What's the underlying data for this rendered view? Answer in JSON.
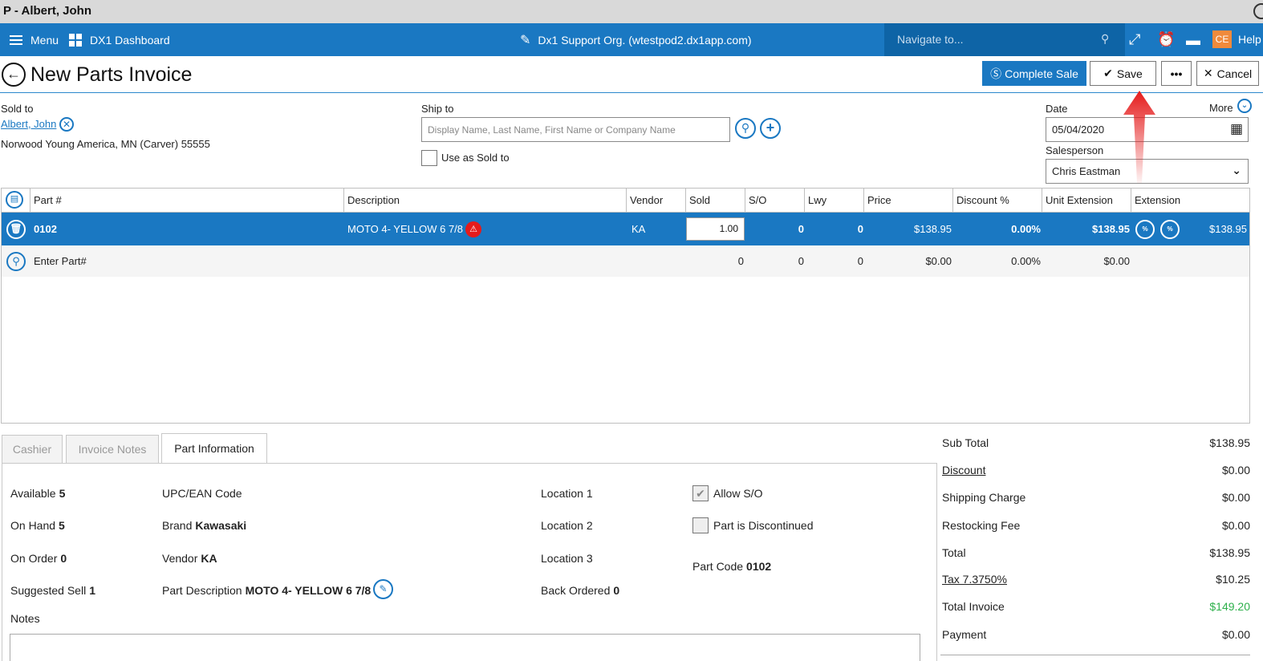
{
  "window": {
    "title": "P - Albert, John"
  },
  "topnav": {
    "menu_label": "Menu",
    "dashboard_label": "DX1 Dashboard",
    "org_label": "Dx1 Support Org. (wtestpod2.dx1app.com)",
    "navigate_placeholder": "Navigate to...",
    "user_initials": "CE",
    "help_label": "Help"
  },
  "header": {
    "title": "New Parts Invoice",
    "complete_sale_label": "Complete Sale",
    "save_label": "Save",
    "more_label": "•••",
    "cancel_label": "Cancel"
  },
  "sold_to": {
    "label": "Sold to",
    "name": "Albert, John",
    "address": "Norwood Young America, MN (Carver) 55555"
  },
  "ship_to": {
    "label": "Ship to",
    "placeholder": "Display Name, Last Name, First Name or Company Name",
    "use_as_sold_label": "Use as Sold to"
  },
  "meta": {
    "more_label": "More",
    "date_label": "Date",
    "date_value": "05/04/2020",
    "salesperson_label": "Salesperson",
    "salesperson_value": "Chris Eastman"
  },
  "grid": {
    "columns": [
      "Part #",
      "Description",
      "Vendor",
      "Sold",
      "S/O",
      "Lwy",
      "Price",
      "Discount %",
      "Unit Extension",
      "Extension"
    ],
    "rows": [
      {
        "part": "0102",
        "description": "MOTO 4- YELLOW 6 7/8",
        "vendor": "KA",
        "sold": "1.00",
        "so": "0",
        "lwy": "0",
        "price": "$138.95",
        "discount": "0.00%",
        "unit_ext": "$138.95",
        "extension": "$138.95"
      }
    ],
    "entry": {
      "placeholder": "Enter Part#",
      "sold": "0",
      "so": "0",
      "lwy": "0",
      "price": "$0.00",
      "discount": "0.00%",
      "unit_ext": "$0.00"
    },
    "discount_badge": "% DISCOUNT",
    "tax_badge": "% TAX"
  },
  "tabs": [
    "Cashier",
    "Invoice Notes",
    "Part Information"
  ],
  "part_info": {
    "available_label": "Available",
    "available": "5",
    "on_hand_label": "On Hand",
    "on_hand": "5",
    "on_order_label": "On Order",
    "on_order": "0",
    "suggested_sell_label": "Suggested Sell",
    "suggested_sell": "1",
    "upc_label": "UPC/EAN Code",
    "brand_label": "Brand",
    "brand": "Kawasaki",
    "vendor_label": "Vendor",
    "vendor": "KA",
    "part_desc_label": "Part Description",
    "part_desc": "MOTO 4- YELLOW 6 7/8",
    "location1_label": "Location 1",
    "location2_label": "Location 2",
    "location3_label": "Location 3",
    "back_ordered_label": "Back Ordered",
    "back_ordered": "0",
    "allow_so_label": "Allow S/O",
    "discontinued_label": "Part is Discontinued",
    "part_code_label": "Part Code",
    "part_code": "0102",
    "notes_label": "Notes"
  },
  "totals": [
    {
      "label": "Sub Total",
      "value": "$138.95"
    },
    {
      "label": "Discount",
      "value": "$0.00"
    },
    {
      "label": "Shipping Charge",
      "value": "$0.00"
    },
    {
      "label": "Restocking Fee",
      "value": "$0.00"
    },
    {
      "label": "Total",
      "value": "$138.95"
    },
    {
      "label": "Tax 7.3750%",
      "value": "$10.25"
    },
    {
      "label": "Total Invoice",
      "value": "$149.20"
    },
    {
      "label": "Payment",
      "value": "$0.00"
    }
  ],
  "colors": {
    "primary": "#1a78c2",
    "nav_dark": "#0e64a6",
    "accent_orange": "#f08a3c",
    "green": "#2db04b",
    "red": "#e51b1b"
  }
}
